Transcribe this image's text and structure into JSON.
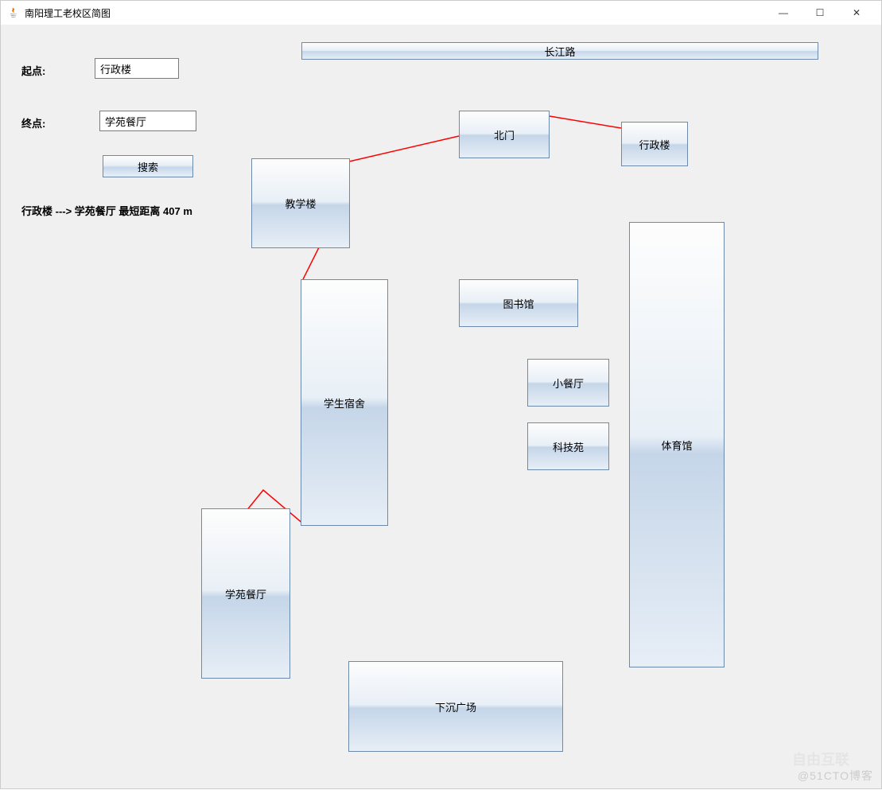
{
  "window": {
    "title": "南阳理工老校区简图"
  },
  "titlebar_buttons": {
    "min": "—",
    "max": "☐",
    "close": "✕"
  },
  "form": {
    "start_label": "起点:",
    "start_value": "行政楼",
    "end_label": "终点:",
    "end_value": "学苑餐厅",
    "search_label": "搜索"
  },
  "result_text": "行政楼 ---> 学苑餐厅 最短距离 407 m",
  "nodes": {
    "changjiang_road": "长江路",
    "north_gate": "北门",
    "admin_building": "行政楼",
    "teaching_building": "教学楼",
    "library": "图书馆",
    "small_canteen": "小餐厅",
    "tech_park": "科技苑",
    "gymnasium": "体育馆",
    "dormitory": "学生宿舍",
    "xueyuan_canteen": "学苑餐厅",
    "sunken_plaza": "下沉广场"
  },
  "edges_path": [
    {
      "from": "admin_building",
      "via": "north_gate",
      "to": "teaching_building",
      "to2": "dormitory",
      "to3": "xueyuan_canteen"
    }
  ],
  "watermarks": {
    "bottom": "@51CTO博客",
    "mid": "自由互联"
  }
}
